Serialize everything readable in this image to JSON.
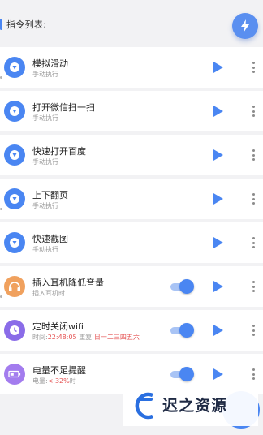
{
  "header": {
    "title": "指令列表:"
  },
  "colors": {
    "accent": "#4a86f2",
    "orange": "#f0a15e",
    "purple": "#8a6ce8",
    "purple_light": "#a37cee"
  },
  "commands": [
    {
      "name": "模拟滑动",
      "subtitle": "手动执行",
      "icon": "cursor-icon"
    },
    {
      "name": "打开微信扫一扫",
      "subtitle": "手动执行",
      "icon": "cursor-icon"
    },
    {
      "name": "快速打开百度",
      "subtitle": "手动执行",
      "icon": "cursor-icon"
    },
    {
      "name": "上下翻页",
      "subtitle": "手动执行",
      "icon": "cursor-icon"
    },
    {
      "name": "快速截图",
      "subtitle": "手动执行",
      "icon": "cursor-icon"
    },
    {
      "name": "插入耳机降低音量",
      "subtitle": "插入耳机时",
      "icon": "headphones-icon",
      "enabled": true
    },
    {
      "name": "定时关闭wifi",
      "subtitle_prefix": "时间:",
      "time": "22:48:05",
      "repeat_prefix": "重复:",
      "repeat_days": "日一二三四五六",
      "icon": "clock-icon",
      "enabled": true
    },
    {
      "name": "电量不足提醒",
      "subtitle_prefix": "电量:",
      "battery_value": "< 32%",
      "subtitle_suffix": "时",
      "icon": "battery-icon",
      "enabled": true
    }
  ],
  "watermark": {
    "text": "迟之资源"
  }
}
